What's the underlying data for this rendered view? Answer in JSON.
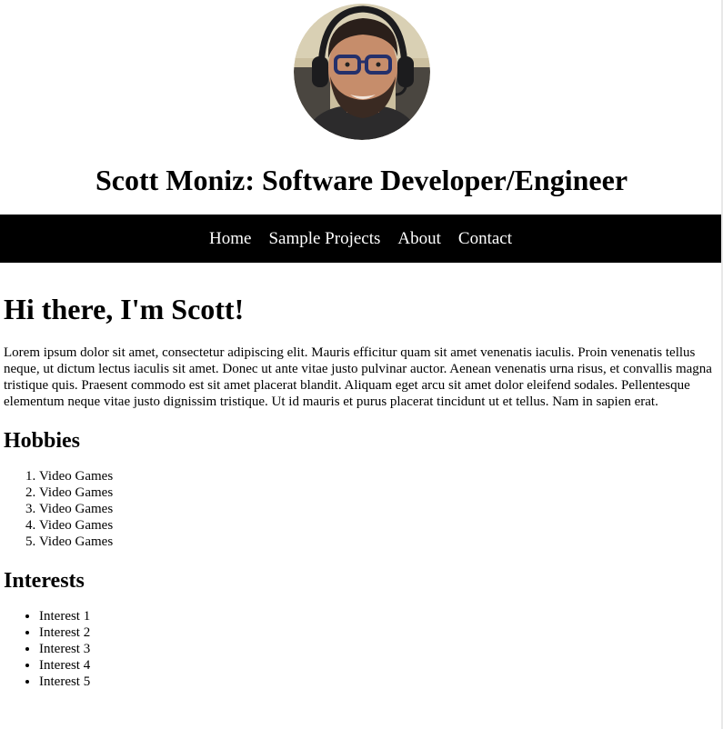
{
  "header": {
    "avatar_alt": "Scott Moniz profile photo",
    "title": "Scott Moniz: Software Developer/Engineer"
  },
  "nav": {
    "items": [
      "Home",
      "Sample Projects",
      "About",
      "Contact"
    ]
  },
  "main": {
    "greeting": "Hi there, I'm Scott!",
    "intro": "Lorem ipsum dolor sit amet, consectetur adipiscing elit. Mauris efficitur quam sit amet venenatis iaculis. Proin venenatis tellus neque, ut dictum lectus iaculis sit amet. Donec ut ante vitae justo pulvinar auctor. Aenean venenatis urna risus, et convallis magna tristique quis. Praesent commodo est sit amet placerat blandit. Aliquam eget arcu sit amet dolor eleifend sodales. Pellentesque elementum neque vitae justo dignissim tristique. Ut id mauris et purus placerat tincidunt ut et tellus. Nam in sapien erat.",
    "hobbies": {
      "heading": "Hobbies",
      "items": [
        "Video Games",
        "Video Games",
        "Video Games",
        "Video Games",
        "Video Games"
      ]
    },
    "interests": {
      "heading": "Interests",
      "items": [
        "Interest 1",
        "Interest 2",
        "Interest 3",
        "Interest 4",
        "Interest 5"
      ]
    }
  },
  "colors": {
    "nav_background": "#000000",
    "nav_text": "#ffffff",
    "page_background": "#ffffff"
  }
}
